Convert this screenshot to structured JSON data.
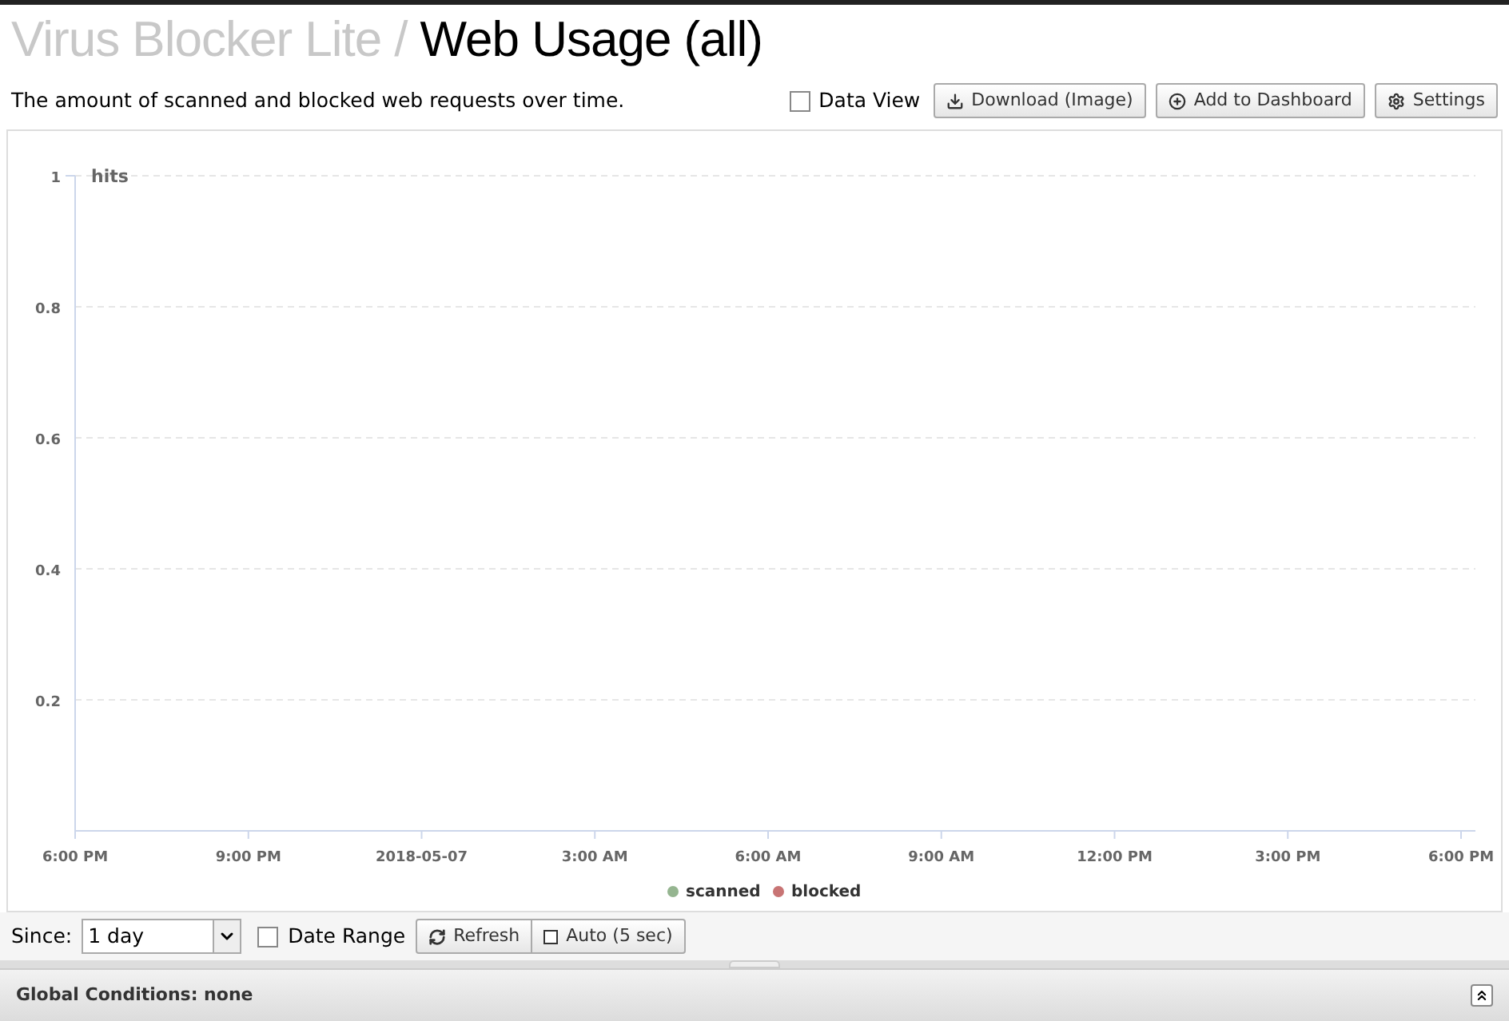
{
  "header": {
    "app": "Virus Blocker Lite",
    "separator": "/",
    "title": "Web Usage (all)"
  },
  "description": "The amount of scanned and blocked web requests over time.",
  "toolbar": {
    "data_view": {
      "label": "Data View",
      "checked": false
    },
    "buttons": [
      "Download (Image)",
      "Add to Dashboard",
      "Settings"
    ]
  },
  "chart_data": {
    "type": "line",
    "ylabel": "hits",
    "ylim": [
      0,
      1
    ],
    "yticks": [
      0.2,
      0.4,
      0.6,
      0.8,
      1
    ],
    "grid": true,
    "categories": [
      "6:00 PM",
      "9:00 PM",
      "2018-05-07",
      "3:00 AM",
      "6:00 AM",
      "9:00 AM",
      "12:00 PM",
      "3:00 PM",
      "6:00 PM"
    ],
    "series": [
      {
        "name": "scanned",
        "color": "#95b590",
        "values": [
          null,
          null,
          null,
          null,
          null,
          null,
          null,
          null,
          null
        ]
      },
      {
        "name": "blocked",
        "color": "#c87474",
        "values": [
          null,
          null,
          null,
          null,
          null,
          null,
          null,
          null,
          null
        ]
      }
    ]
  },
  "filter": {
    "since_label": "Since:",
    "since_value": "1 day",
    "date_range": {
      "label": "Date Range",
      "checked": false
    },
    "refresh": "Refresh",
    "auto": {
      "label": "Auto (5 sec)",
      "checked": false
    }
  },
  "global_conditions": "Global Conditions: none"
}
